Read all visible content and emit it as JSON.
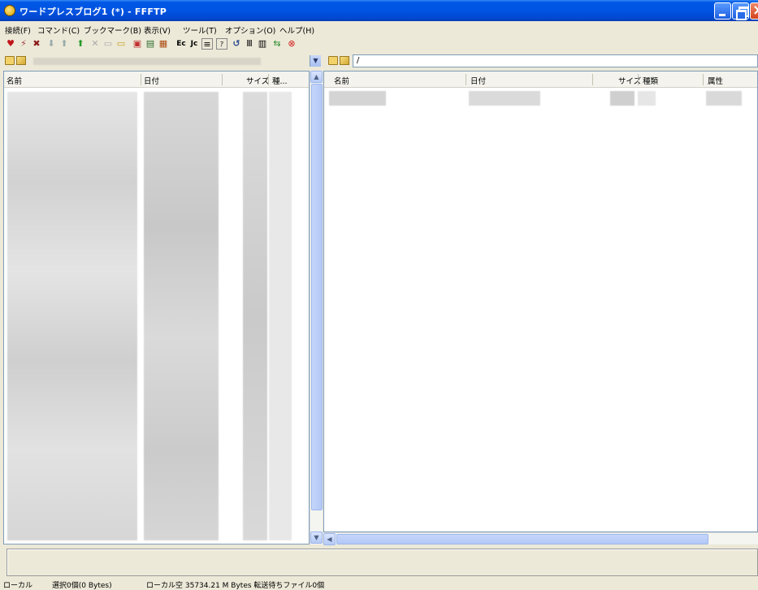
{
  "window": {
    "title": "ワードプレスブログ1 (*) - FFFTP"
  },
  "menu": [
    "接続(F)",
    "コマンド(C)",
    "ブックマーク(B)",
    "表示(V)",
    "ツール(T)",
    "オプション(O)",
    "ヘルプ(H)"
  ],
  "local": {
    "path": "",
    "columns": [
      "名前",
      "日付",
      "サイズ",
      "種..."
    ]
  },
  "remote": {
    "path": "/",
    "columns": [
      "名前",
      "日付",
      "サイズ",
      "種類",
      "属性"
    ]
  },
  "status": {
    "side": "ローカル",
    "selection": "選択0個(0 Bytes)",
    "free": "ローカル空 35734.21 M Bytes 転送待ちファイル0個"
  },
  "toolbar_icons": [
    "connect-icon",
    "quick-connect-icon",
    "disconnect-icon",
    "download-icon",
    "upload-icon",
    "mirror-upload-icon",
    "delete-icon",
    "rename-icon",
    "mkdir-icon",
    "chdir-icon",
    "list-icon",
    "report-icon",
    "sjis-icon",
    "jis-icon",
    "euc-icon",
    "halfwidth-kana-icon",
    "refresh-icon",
    "list-view-icon",
    "detail-view-icon",
    "sync-icon",
    "stop-icon"
  ]
}
